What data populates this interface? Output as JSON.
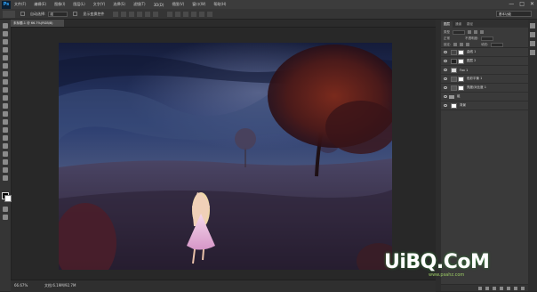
{
  "app": {
    "logo": "Ps"
  },
  "menu": [
    "文件(F)",
    "编辑(E)",
    "图像(I)",
    "图层(L)",
    "文字(Y)",
    "选择(S)",
    "滤镜(T)",
    "3D(D)",
    "视图(V)",
    "窗口(W)",
    "帮助(H)"
  ],
  "window_controls": [
    "—",
    "□",
    "✕"
  ],
  "options": {
    "auto_select_label": "自动选择:",
    "auto_select_value": "组",
    "show_transform_label": "显示变换控件",
    "workspace": "基本功能"
  },
  "document": {
    "tab_title": "未标题-1 @ 66.7%(RGB/8)"
  },
  "status": {
    "zoom": "66.67%",
    "doc_info": "文档:6.19M/92.7M"
  },
  "layers_panel": {
    "tabs": [
      "图层",
      "通道",
      "路径"
    ],
    "filter_label": "类型",
    "blend_mode": "正常",
    "opacity_label": "不透明度:",
    "lock_label": "锁定:",
    "fill_label": "填充:",
    "layers": [
      {
        "name": "曲线 1",
        "visible": true,
        "selected": false,
        "thumb_color": "#444444",
        "has_mask": true
      },
      {
        "name": "图层 2",
        "visible": true,
        "selected": false,
        "thumb_color": "#222222",
        "has_mask": true
      },
      {
        "name": "Fox 1",
        "visible": true,
        "selected": false,
        "thumb_color": "#dddddd",
        "has_mask": false
      },
      {
        "name": "色彩平衡 1",
        "visible": true,
        "selected": false,
        "thumb_color": "#555555",
        "has_mask": true
      },
      {
        "name": "亮度/对比度 1",
        "visible": true,
        "selected": false,
        "thumb_color": "#555555",
        "has_mask": true
      },
      {
        "name": "组",
        "visible": true,
        "selected": false,
        "thumb_color": "#999999",
        "has_mask": false,
        "is_group": true
      },
      {
        "name": "背景",
        "visible": true,
        "selected": false,
        "thumb_color": "#ffffff",
        "has_mask": false
      }
    ]
  },
  "watermark": {
    "text": "UiBQ.CoM",
    "sub": "www.psahz.com"
  }
}
